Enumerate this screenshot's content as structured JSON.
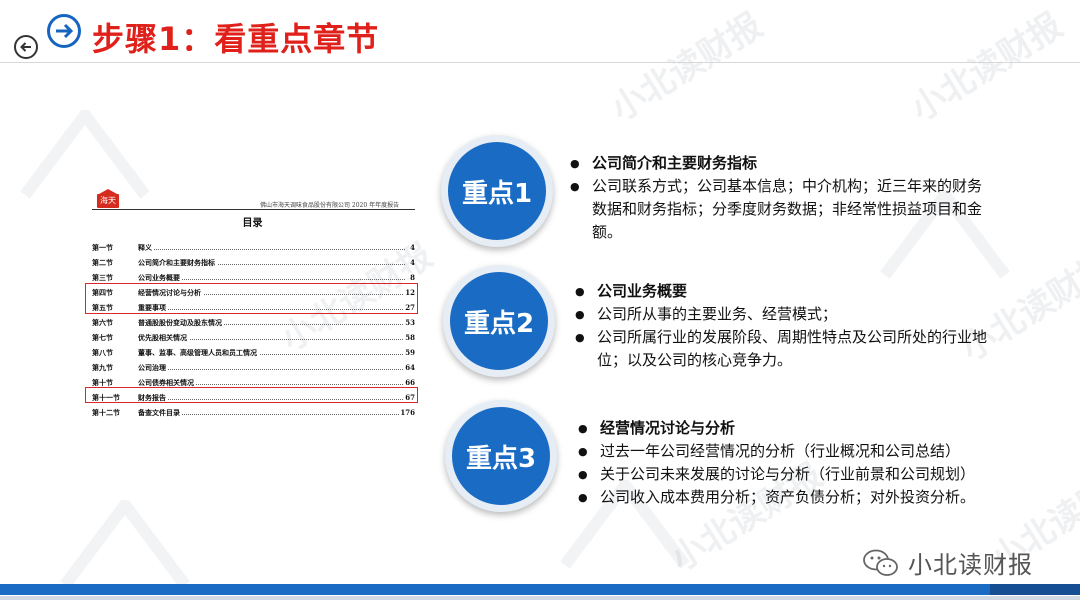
{
  "header": {
    "title": "步骤1：看重点章节"
  },
  "watermark": "小北读财报",
  "document": {
    "logo": "海天",
    "company": "佛山市海天调味食品股份有限公司 2020 年年度报告",
    "toc_title": "目录",
    "rows": [
      {
        "section": "第一节",
        "title": "释义",
        "page": "4"
      },
      {
        "section": "第二节",
        "title": "公司简介和主要财务指标",
        "page": "4"
      },
      {
        "section": "第三节",
        "title": "公司业务概要",
        "page": "8"
      },
      {
        "section": "第四节",
        "title": "经营情况讨论与分析",
        "page": "12"
      },
      {
        "section": "第五节",
        "title": "重要事项",
        "page": "27"
      },
      {
        "section": "第六节",
        "title": "普通股股份变动及股东情况",
        "page": "53"
      },
      {
        "section": "第七节",
        "title": "优先股相关情况",
        "page": "58"
      },
      {
        "section": "第八节",
        "title": "董事、监事、高级管理人员和员工情况",
        "page": "59"
      },
      {
        "section": "第九节",
        "title": "公司治理",
        "page": "64"
      },
      {
        "section": "第十节",
        "title": "公司债券相关情况",
        "page": "66"
      },
      {
        "section": "第十一节",
        "title": "财务报告",
        "page": "67"
      },
      {
        "section": "第十二节",
        "title": "备查文件目录",
        "page": "176"
      }
    ]
  },
  "points": [
    {
      "label": "重点1",
      "heading": "公司简介和主要财务指标",
      "items": [
        "公司联系方式；公司基本信息；中介机构；近三年来的财务数据和财务指标；分季度财务数据；非经常性损益项目和金额。"
      ]
    },
    {
      "label": "重点2",
      "heading": "公司业务概要",
      "items": [
        "公司所从事的主要业务、经营模式；",
        "公司所属行业的发展阶段、周期性特点及公司所处的行业地位；以及公司的核心竞争力。"
      ]
    },
    {
      "label": "重点3",
      "heading": "经营情况讨论与分析",
      "items": [
        "过去一年公司经营情况的分析（行业概况和公司总结）",
        "关于公司未来发展的讨论与分析（行业前景和公司规划）",
        "公司收入成本费用分析；资产负债分析；对外投资分析。"
      ]
    }
  ],
  "footer": {
    "brand": "小北读财报"
  },
  "colors": {
    "title": "#e0201b",
    "accent_blue": "#1a6bc4",
    "highlight_red": "#d9262a"
  },
  "icons": {
    "back": "back-arrow-icon",
    "next": "next-arrow-icon",
    "wechat": "wechat-icon"
  }
}
